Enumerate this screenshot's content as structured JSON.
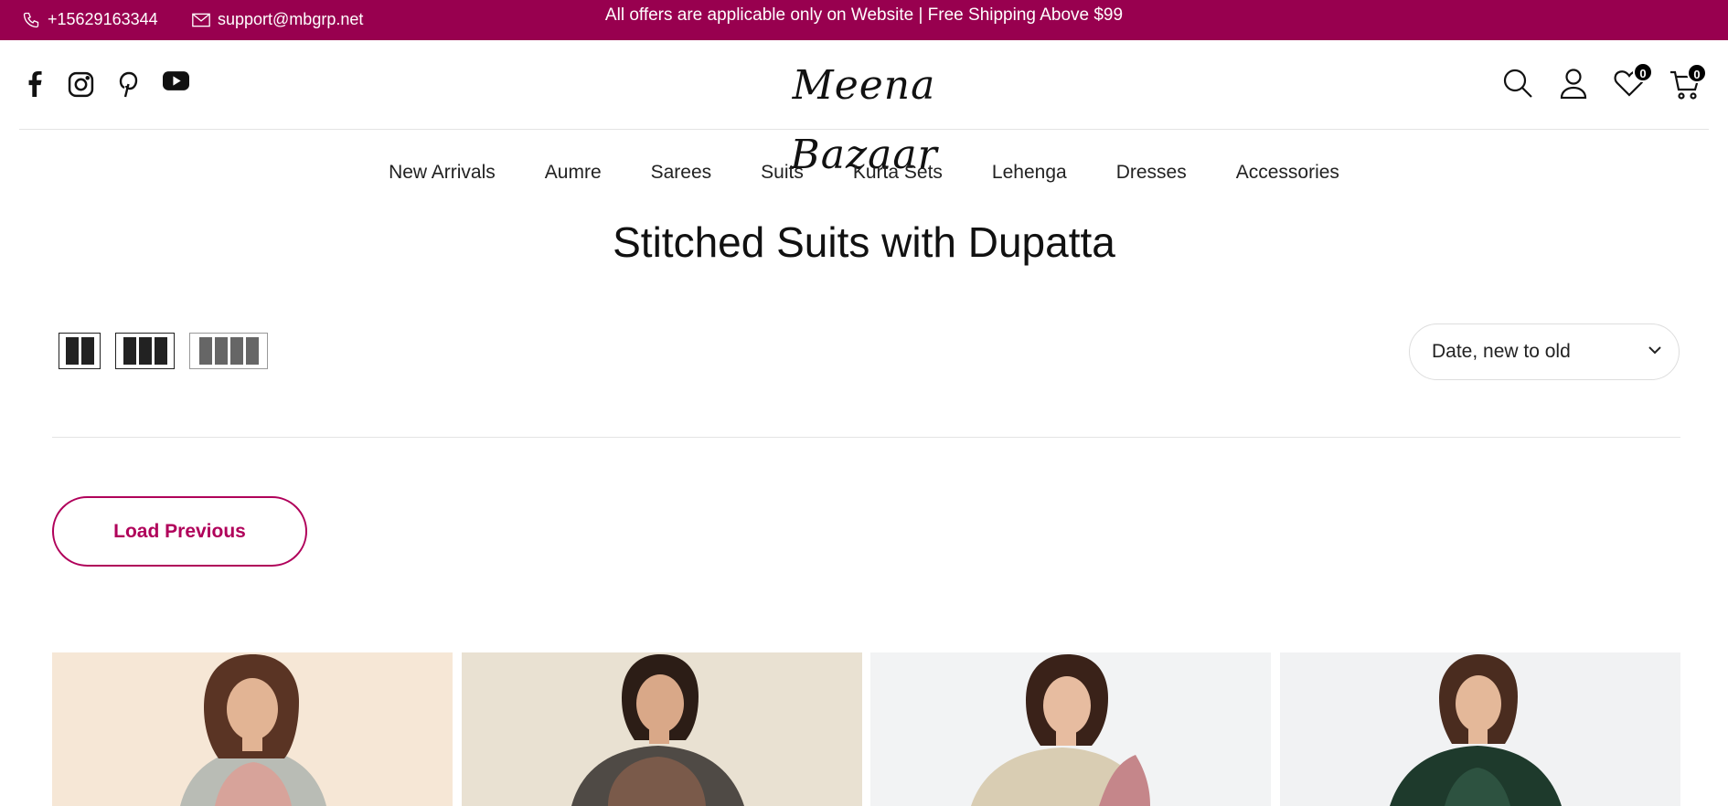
{
  "topbar": {
    "phone": "+15629163344",
    "email": "support@mbgrp.net",
    "promo": "All offers are applicable only on Website | Free Shipping Above $99",
    "bg_color": "#98004f"
  },
  "header": {
    "logo_text": "Meena Bazaar",
    "social": [
      "facebook-icon",
      "instagram-icon",
      "pinterest-icon",
      "youtube-icon"
    ],
    "wishlist_count": "0",
    "cart_count": "0"
  },
  "nav": {
    "items": [
      "New Arrivals",
      "Aumre",
      "Sarees",
      "Suits",
      "Kurta Sets",
      "Lehenga",
      "Dresses",
      "Accessories"
    ]
  },
  "collection": {
    "title": "Stitched Suits with Dupatta",
    "sort_selected": "Date, new to old",
    "load_previous": "Load Previous",
    "grid_options": [
      "2-columns",
      "3-columns",
      "4-columns"
    ],
    "accent_color": "#b0005a"
  },
  "products": [
    {
      "image": "model-in-grey-floral-suit"
    },
    {
      "image": "model-in-dark-printed-suit-with-dupatta"
    },
    {
      "image": "model-in-beige-suit-with-pink-dupatta"
    },
    {
      "image": "model-in-green-embroidered-suit"
    }
  ]
}
